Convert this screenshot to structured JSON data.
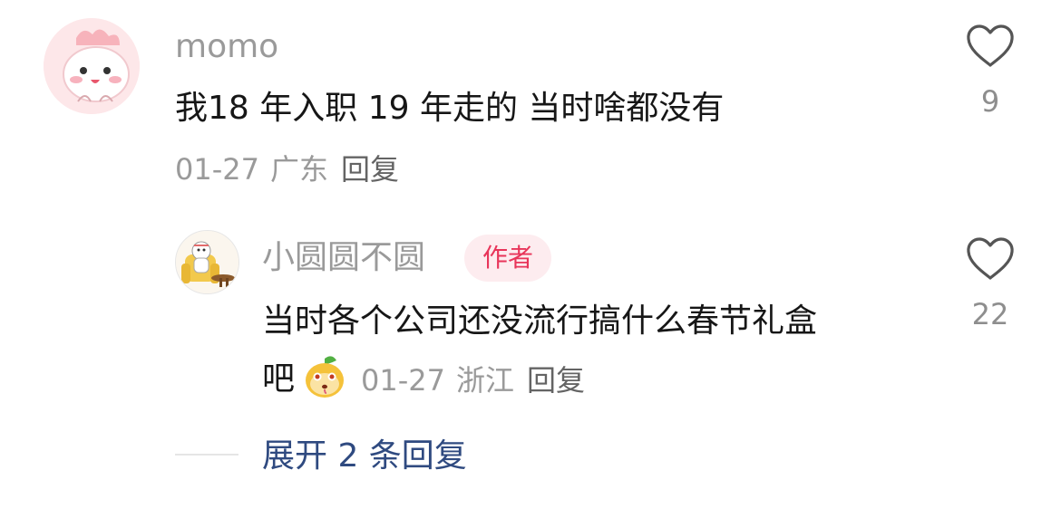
{
  "comment": {
    "username": "momo",
    "text": "我18 年入职 19 年走的 当时啥都没有",
    "date": "01-27",
    "location": "广东",
    "reply_label": "回复",
    "likes": "9"
  },
  "reply": {
    "username": "小圆圆不圆",
    "badge": "作者",
    "text_line1": "当时各个公司还没流行搞什么春节礼盒",
    "text_line2": "吧",
    "emoji": "emoji-sticker-icon",
    "date": "01-27",
    "location": "浙江",
    "reply_label": "回复",
    "likes": "22"
  },
  "expand": {
    "label": "展开 2 条回复"
  },
  "colors": {
    "username": "#9a9a9a",
    "content": "#161616",
    "meta": "#9a9a9a",
    "badge_bg": "#fdecef",
    "badge_text": "#e8355a",
    "expand": "#2f4a80"
  }
}
